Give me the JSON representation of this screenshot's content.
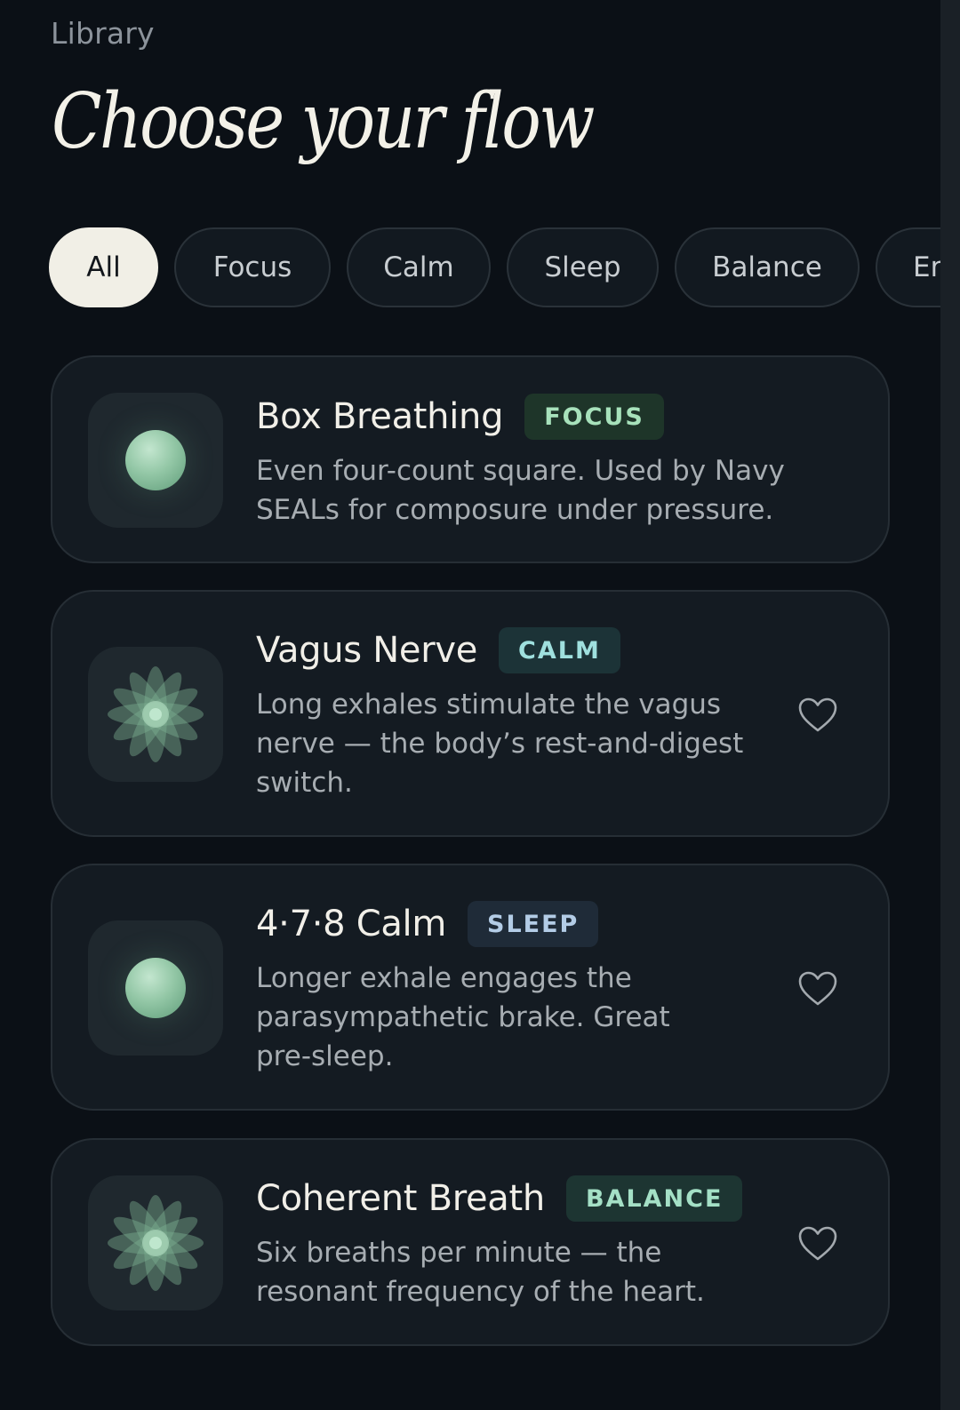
{
  "header": {
    "eyebrow": "Library",
    "title": "Choose your flow"
  },
  "filters": [
    {
      "label": "All",
      "active": true
    },
    {
      "label": "Focus",
      "active": false
    },
    {
      "label": "Calm",
      "active": false
    },
    {
      "label": "Sleep",
      "active": false
    },
    {
      "label": "Balance",
      "active": false
    },
    {
      "label": "Er",
      "active": false
    }
  ],
  "sessions": [
    {
      "title": "Box Breathing",
      "tag": "FOCUS",
      "tag_color": "#a7e2bb",
      "tag_bg": "#1e3529",
      "description": "Even four-count square. Used by Navy SEALs for composure under pressure.",
      "icon": "orb-icon",
      "favorite_icon": null
    },
    {
      "title": "Vagus Nerve",
      "tag": "CALM",
      "tag_color": "#9fe0de",
      "tag_bg": "#1c3337",
      "description": "Long exhales stimulate the vagus nerve — the body’s rest-and-digest switch.",
      "icon": "flower-icon",
      "favorite_icon": "heart-icon"
    },
    {
      "title": "4·7·8 Calm",
      "tag": "SLEEP",
      "tag_color": "#b3cce6",
      "tag_bg": "#1f2b38",
      "description": "Longer exhale engages the parasympathetic brake. Great pre-sleep.",
      "icon": "orb-icon",
      "favorite_icon": "heart-icon"
    },
    {
      "title": "Coherent Breath",
      "tag": "BALANCE",
      "tag_color": "#a4e0c6",
      "tag_bg": "#1d3532",
      "description": "Six breaths per minute — the resonant frequency of the heart.",
      "icon": "flower-icon",
      "favorite_icon": "heart-icon"
    }
  ],
  "colors": {
    "background": "#0b1016",
    "card": "#141b22",
    "accent": "#93c7a6"
  }
}
